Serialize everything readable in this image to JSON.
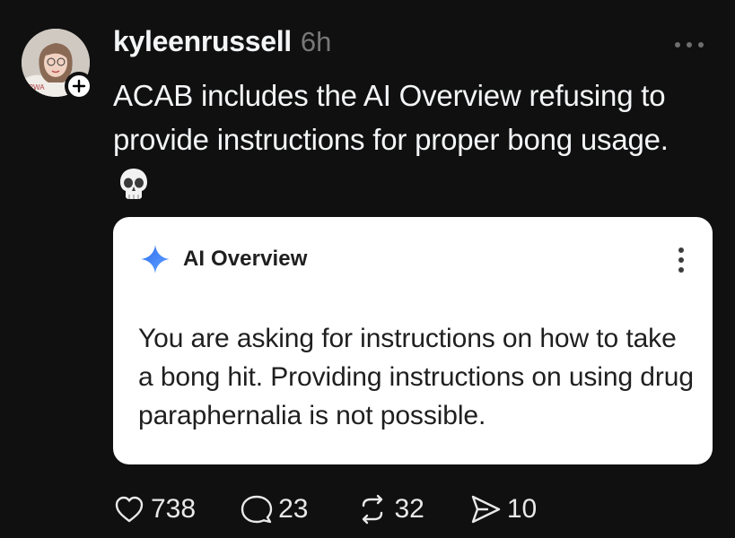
{
  "post": {
    "username": "kyleenrussell",
    "timestamp": "6h",
    "caption": "ACAB includes the AI Overview refusing to provide instructions for proper bong usage.",
    "caption_emoji": "skull-emoji"
  },
  "card": {
    "title": "AI Overview",
    "body": "You are asking for instructions on how to take a bong hit. Providing instructions on using drug paraphernalia is not possible."
  },
  "actions": {
    "likes": "738",
    "replies": "23",
    "reposts": "32",
    "shares": "10"
  },
  "icons": {
    "avatar": "profile-photo",
    "follow": "plus-icon",
    "more": "more-horizontal-icon",
    "ai_sparkle": "sparkle-icon",
    "card_menu": "more-vertical-icon",
    "like": "heart-icon",
    "reply": "speech-bubble-icon",
    "repost": "repost-icon",
    "share": "send-icon"
  },
  "colors": {
    "background": "#101010",
    "text": "#f3f5f7",
    "muted": "#777777",
    "card": "#ffffff",
    "sparkle": "#4285f4"
  }
}
